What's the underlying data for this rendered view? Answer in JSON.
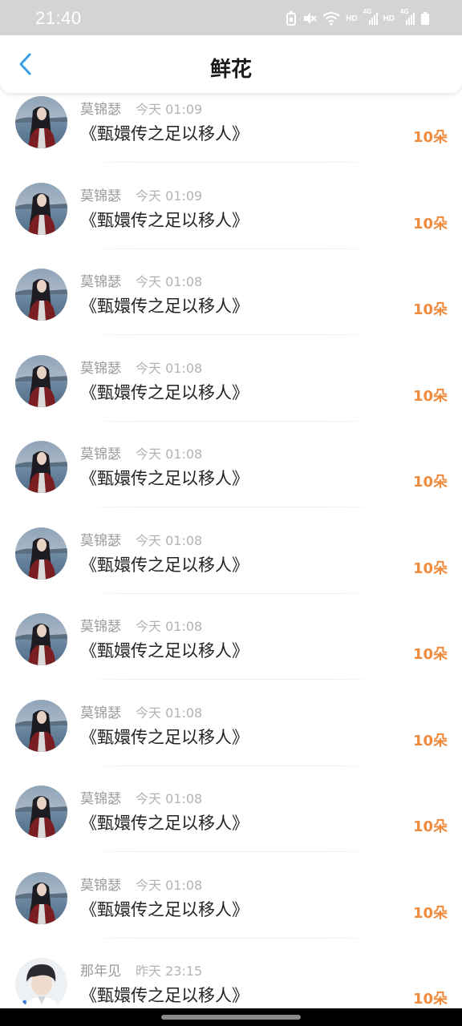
{
  "status_bar": {
    "time": "21:40",
    "network_tag_1": "HD",
    "network_tag_2": "HD",
    "signal_gen_1": "4G",
    "signal_gen_2": "4G"
  },
  "header": {
    "title": "鲜花",
    "back_icon": "chevron-left-icon"
  },
  "colors": {
    "accent": "#3a9ee8",
    "count": "#f08a3c",
    "name": "#9a9a9a",
    "time": "#b3b3b3"
  },
  "items": [
    {
      "user": "莫锦瑟",
      "time": "今天 01:09",
      "book": "《甄嬛传之足以移人》",
      "count": "10朵",
      "avatar": "girl-avatar"
    },
    {
      "user": "莫锦瑟",
      "time": "今天 01:09",
      "book": "《甄嬛传之足以移人》",
      "count": "10朵",
      "avatar": "girl-avatar"
    },
    {
      "user": "莫锦瑟",
      "time": "今天 01:08",
      "book": "《甄嬛传之足以移人》",
      "count": "10朵",
      "avatar": "girl-avatar"
    },
    {
      "user": "莫锦瑟",
      "time": "今天 01:08",
      "book": "《甄嬛传之足以移人》",
      "count": "10朵",
      "avatar": "girl-avatar"
    },
    {
      "user": "莫锦瑟",
      "time": "今天 01:08",
      "book": "《甄嬛传之足以移人》",
      "count": "10朵",
      "avatar": "girl-avatar"
    },
    {
      "user": "莫锦瑟",
      "time": "今天 01:08",
      "book": "《甄嬛传之足以移人》",
      "count": "10朵",
      "avatar": "girl-avatar"
    },
    {
      "user": "莫锦瑟",
      "time": "今天 01:08",
      "book": "《甄嬛传之足以移人》",
      "count": "10朵",
      "avatar": "girl-avatar"
    },
    {
      "user": "莫锦瑟",
      "time": "今天 01:08",
      "book": "《甄嬛传之足以移人》",
      "count": "10朵",
      "avatar": "girl-avatar"
    },
    {
      "user": "莫锦瑟",
      "time": "今天 01:08",
      "book": "《甄嬛传之足以移人》",
      "count": "10朵",
      "avatar": "girl-avatar"
    },
    {
      "user": "莫锦瑟",
      "time": "今天 01:08",
      "book": "《甄嬛传之足以移人》",
      "count": "10朵",
      "avatar": "girl-avatar"
    },
    {
      "user": "那年见",
      "time": "昨天 23:15",
      "book": "《甄嬛传之足以移人》",
      "count": "10朵",
      "avatar": "boy-avatar"
    }
  ]
}
